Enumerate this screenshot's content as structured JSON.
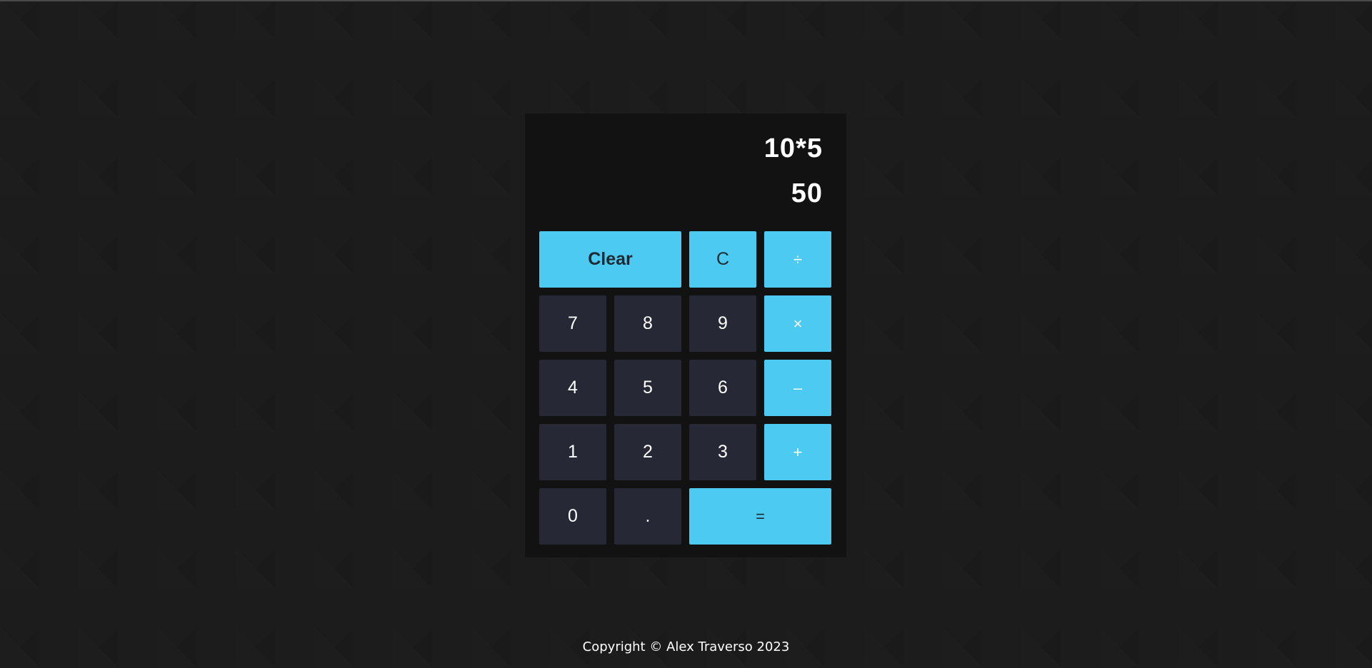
{
  "display": {
    "expression": "10*5",
    "result": "50"
  },
  "buttons": {
    "clear": "Clear",
    "c": "C",
    "divide": "÷",
    "seven": "7",
    "eight": "8",
    "nine": "9",
    "multiply": "×",
    "four": "4",
    "five": "5",
    "six": "6",
    "subtract": "–",
    "one": "1",
    "two": "2",
    "three": "3",
    "add": "+",
    "zero": "0",
    "decimal": ".",
    "equals": "="
  },
  "footer": {
    "text": "Copyright © Alex Traverso 2023"
  },
  "colors": {
    "accent": "#4ccaf1",
    "number_button": "#262935",
    "calculator_bg": "#121212",
    "page_bg": "#1c1c1d"
  }
}
